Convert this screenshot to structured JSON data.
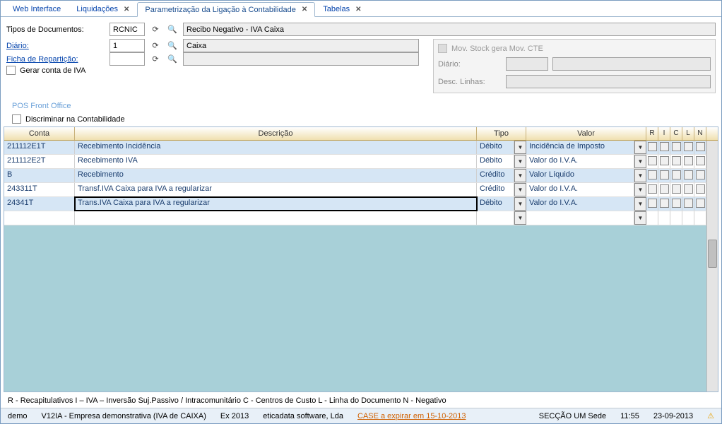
{
  "tabs": [
    {
      "label": "Web Interface",
      "closable": false
    },
    {
      "label": "Liquidações",
      "closable": true
    },
    {
      "label": "Parametrização da Ligação à Contabilidade",
      "closable": true,
      "active": true
    },
    {
      "label": "Tabelas",
      "closable": true
    }
  ],
  "form": {
    "tipos_documentos_label": "Tipos de Documentos:",
    "tipos_documentos_value": "RCNIC",
    "tipos_documentos_desc": "Recibo Negativo - IVA Caixa",
    "diario_label": "Diário:",
    "diario_value": "1",
    "diario_desc": "Caixa",
    "ficha_label": "Ficha de Repartição:",
    "ficha_value": "",
    "gerar_iva_label": "Gerar conta de IVA",
    "pos_label": "POS Front Office",
    "discriminar_label": "Discriminar na Contabilidade",
    "mov_stock_label": "Mov. Stock gera Mov. CTE",
    "r_diario_label": "Diário:",
    "r_desc_linhas_label": "Desc. Linhas:"
  },
  "grid": {
    "headers": {
      "conta": "Conta",
      "descricao": "Descrição",
      "tipo": "Tipo",
      "valor": "Valor",
      "R": "R",
      "I": "I",
      "C": "C",
      "L": "L",
      "N": "N"
    },
    "rows": [
      {
        "conta": "211112E1T",
        "desc": "Recebimento Incidência",
        "tipo": "Débito",
        "valor": "Incidência de Imposto",
        "alt": true
      },
      {
        "conta": "211112E2T",
        "desc": "Recebimento IVA",
        "tipo": "Débito",
        "valor": "Valor do I.V.A.",
        "alt": false
      },
      {
        "conta": "B",
        "desc": "Recebimento",
        "tipo": "Crédito",
        "valor": "Valor Líquido",
        "alt": true
      },
      {
        "conta": "243311T",
        "desc": "Transf.IVA Caixa para IVA a regularizar",
        "tipo": "Crédito",
        "valor": "Valor do I.V.A.",
        "alt": false
      },
      {
        "conta": "24341T",
        "desc": "Trans.IVA Caixa para IVA a regularizar",
        "tipo": "Débito",
        "valor": "Valor do I.V.A.",
        "alt": true,
        "selected": true
      },
      {
        "conta": "",
        "desc": "",
        "tipo": "",
        "valor": "",
        "alt": false,
        "empty": true
      }
    ]
  },
  "legend": "R - Recapitulativos   I – IVA – Inversão Suj.Passivo / Intracomunitário   C - Centros de Custo   L -  Linha do Documento N - Negativo",
  "status": {
    "user": "demo",
    "company": "V12IA - Empresa demonstrativa (IVA de CAIXA)",
    "ex": "Ex 2013",
    "vendor": "eticadata software, Lda",
    "warn": "CASE a expirar em 15-10-2013",
    "section": "SECÇÃO UM Sede",
    "time": "11:55",
    "date": "23-09-2013"
  }
}
